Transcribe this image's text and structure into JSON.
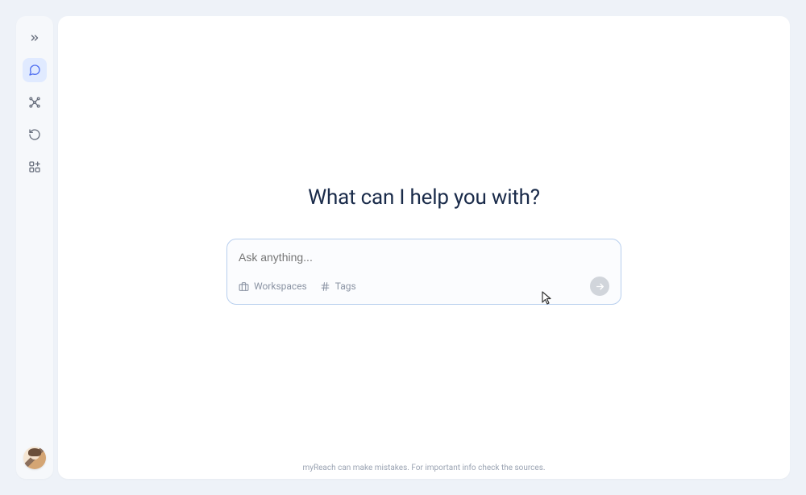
{
  "sidebar": {
    "icons": {
      "expand": "chevron-double-right",
      "assistant": "chat-bubble",
      "network": "network-graph",
      "history": "clock-refresh",
      "apps": "apps-grid"
    }
  },
  "main": {
    "heading": "What can I help you with?",
    "input": {
      "placeholder": "Ask anything...",
      "value": ""
    },
    "chips": {
      "workspaces": {
        "label": "Workspaces",
        "icon": "briefcase"
      },
      "tags": {
        "label": "Tags",
        "icon": "hash"
      }
    },
    "submit_icon": "arrow-right"
  },
  "footer": {
    "disclaimer": "myReach can make mistakes. For important info check the sources."
  }
}
